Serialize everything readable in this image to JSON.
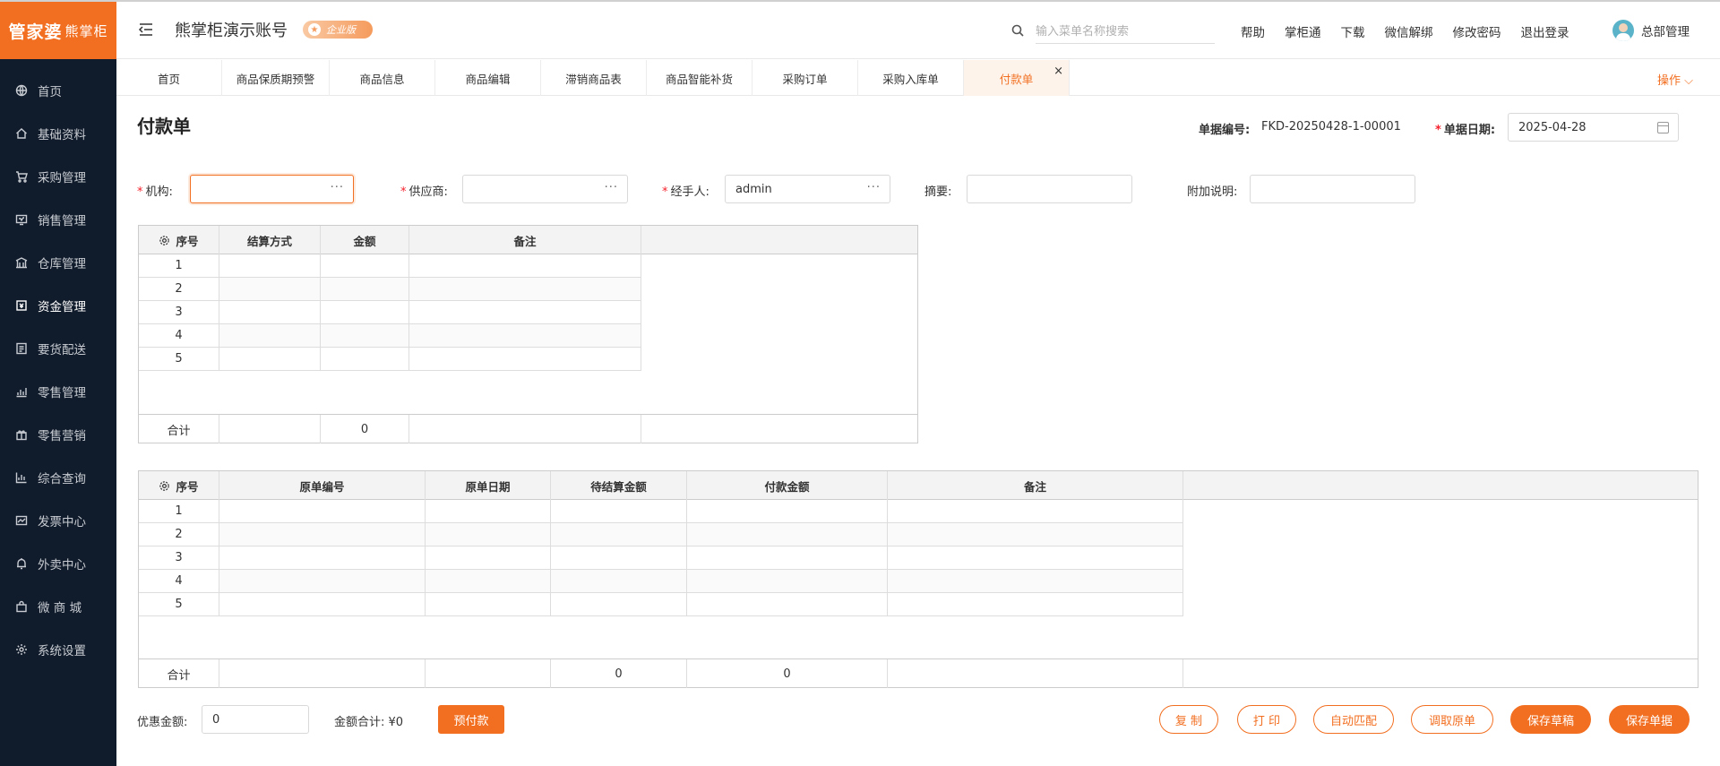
{
  "sidebar": {
    "logo_main": "管家婆",
    "logo_sub": "熊掌柜",
    "items": [
      {
        "label": "首页",
        "icon": "globe-icon"
      },
      {
        "label": "基础资料",
        "icon": "home-icon"
      },
      {
        "label": "采购管理",
        "icon": "cart-icon"
      },
      {
        "label": "销售管理",
        "icon": "monitor-icon"
      },
      {
        "label": "仓库管理",
        "icon": "warehouse-icon"
      },
      {
        "label": "资金管理",
        "icon": "wallet-icon"
      },
      {
        "label": "要货配送",
        "icon": "list-icon"
      },
      {
        "label": "零售管理",
        "icon": "chart-icon"
      },
      {
        "label": "零售营销",
        "icon": "gift-icon"
      },
      {
        "label": "综合查询",
        "icon": "bar-chart-icon"
      },
      {
        "label": "发票中心",
        "icon": "invoice-icon"
      },
      {
        "label": "外卖中心",
        "icon": "bell-icon"
      },
      {
        "label": "微 商 城",
        "icon": "bag-icon"
      },
      {
        "label": "系统设置",
        "icon": "gear-icon"
      }
    ],
    "active_index": 5
  },
  "header": {
    "account": "熊掌柜演示账号",
    "edition": "企业版",
    "search_placeholder": "输入菜单名称搜索",
    "links": [
      "帮助",
      "掌柜通",
      "下载",
      "微信解绑",
      "修改密码",
      "退出登录"
    ],
    "user": "总部管理"
  },
  "tabs": {
    "items": [
      "首页",
      "商品保质期预警",
      "商品信息",
      "商品编辑",
      "滞销商品表",
      "商品智能补货",
      "采购订单",
      "采购入库单",
      "付款单"
    ],
    "active": "付款单",
    "close": "×",
    "ops": "操作 ⌵"
  },
  "form": {
    "title": "付款单",
    "doc_no_label": "单据编号:",
    "doc_no": "FKD-20250428-1-00001",
    "date_label": "单据日期:",
    "date": "2025-04-28",
    "org_label": "机构:",
    "supplier_label": "供应商:",
    "handler_label": "经手人:",
    "handler": "admin",
    "summary_label": "摘要:",
    "note_label": "附加说明:",
    "dots": "···"
  },
  "table1": {
    "headers": [
      "序号",
      "结算方式",
      "金额",
      "备注"
    ],
    "rows": [
      "1",
      "2",
      "3",
      "4",
      "5"
    ],
    "total_label": "合计",
    "total_amount": "0"
  },
  "table2": {
    "headers": [
      "序号",
      "原单编号",
      "原单日期",
      "待结算金额",
      "付款金额",
      "备注"
    ],
    "rows": [
      "1",
      "2",
      "3",
      "4",
      "5"
    ],
    "total_label": "合计",
    "total_pending": "0",
    "total_pay": "0"
  },
  "bottom": {
    "discount_label": "优惠金额:",
    "discount_value": "0",
    "sum_label": "金额合计: ¥0",
    "prepay": "预付款",
    "buttons": [
      "复 制",
      "打 印",
      "自动匹配",
      "调取原单",
      "保存草稿",
      "保存单据"
    ]
  },
  "colors": {
    "accent": "#f26f21",
    "sidebar": "#101b2b"
  }
}
